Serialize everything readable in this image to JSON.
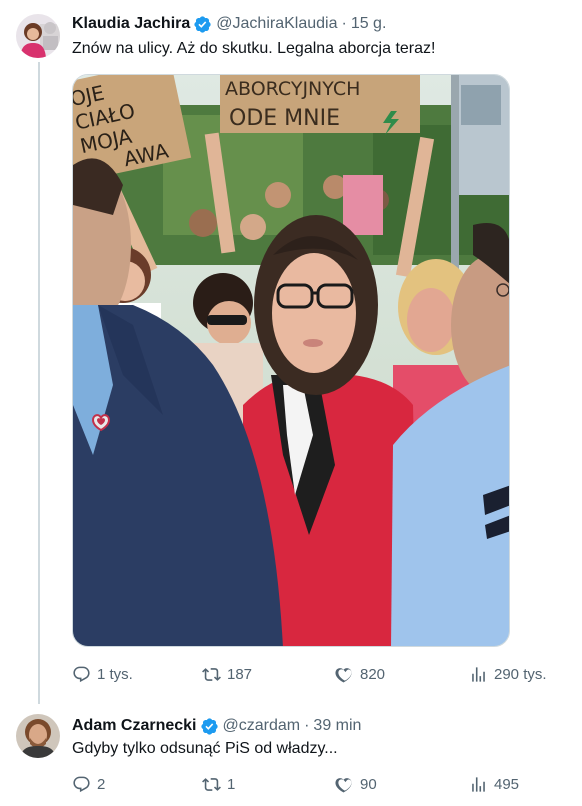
{
  "tweet1": {
    "name": "Klaudia Jachira",
    "handle": "@JachiraKlaudia",
    "separator": "·",
    "time": "15 g.",
    "text": "Znów na ulicy. Aż do skutku. Legalna aborcja teraz!",
    "media": {
      "sign_left_lines": [
        "OJE",
        "CIAŁO",
        "MOJA",
        "AWA"
      ],
      "sign_right_lines": [
        "ABORCYJNYCH",
        "ODE   MNIE"
      ]
    },
    "stats": {
      "replies": "1 tys.",
      "retweets": "187",
      "likes": "820",
      "views": "290 tys."
    }
  },
  "tweet2": {
    "name": "Adam Czarnecki",
    "handle": "@czardam",
    "separator": "·",
    "time": "39 min",
    "text": "Gdyby tylko odsunąć PiS od władzy...",
    "stats": {
      "replies": "2",
      "retweets": "1",
      "likes": "90",
      "views": "495"
    }
  },
  "colors": {
    "verified": "#1d9bf0",
    "text_secondary": "#536471",
    "thread_line": "#cfd9de"
  }
}
